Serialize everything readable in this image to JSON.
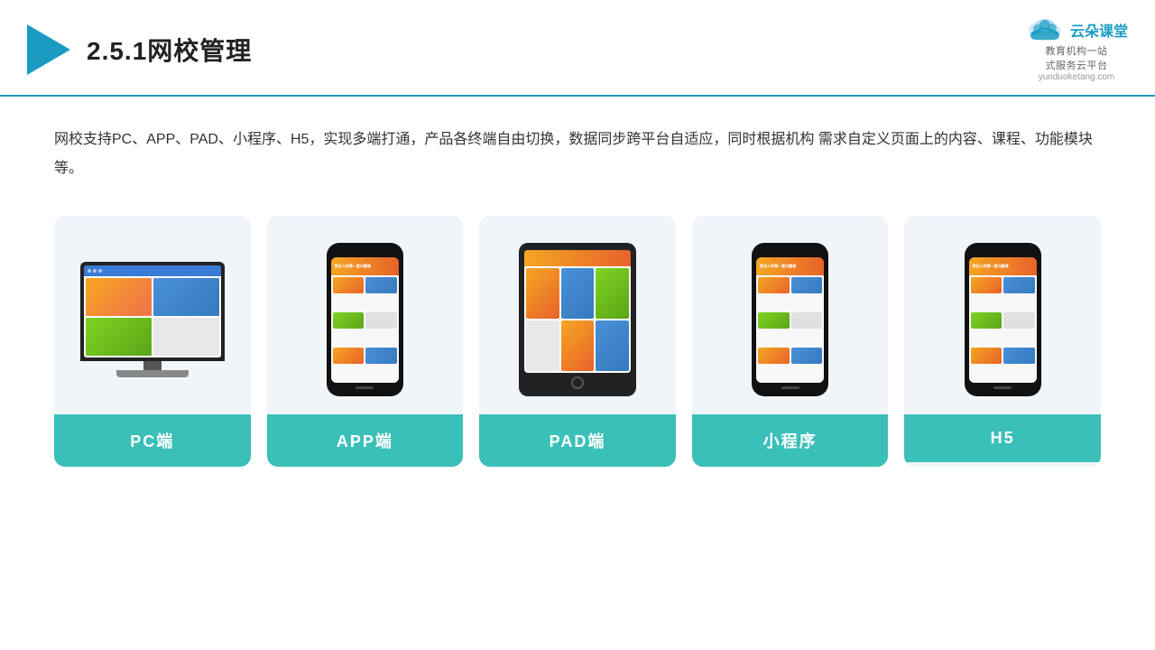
{
  "header": {
    "title": "2.5.1网校管理",
    "brand_name": "云朵课堂",
    "brand_sub": "教育机构一站\n式服务云平台",
    "brand_url": "yunduoketang.com"
  },
  "description": "网校支持PC、APP、PAD、小程序、H5，实现多端打通，产品各终端自由切换，数据同步跨平台自适应，同时根据机构\n需求自定义页面上的内容、课程、功能模块等。",
  "cards": [
    {
      "id": "pc",
      "label": "PC端",
      "type": "pc"
    },
    {
      "id": "app",
      "label": "APP端",
      "type": "phone"
    },
    {
      "id": "pad",
      "label": "PAD端",
      "type": "tablet"
    },
    {
      "id": "mini",
      "label": "小程序",
      "type": "phone"
    },
    {
      "id": "h5",
      "label": "H5",
      "type": "phone"
    }
  ],
  "colors": {
    "accent": "#3bbfb9",
    "header_line": "#1a9cc2",
    "triangle": "#1a9cc2"
  }
}
